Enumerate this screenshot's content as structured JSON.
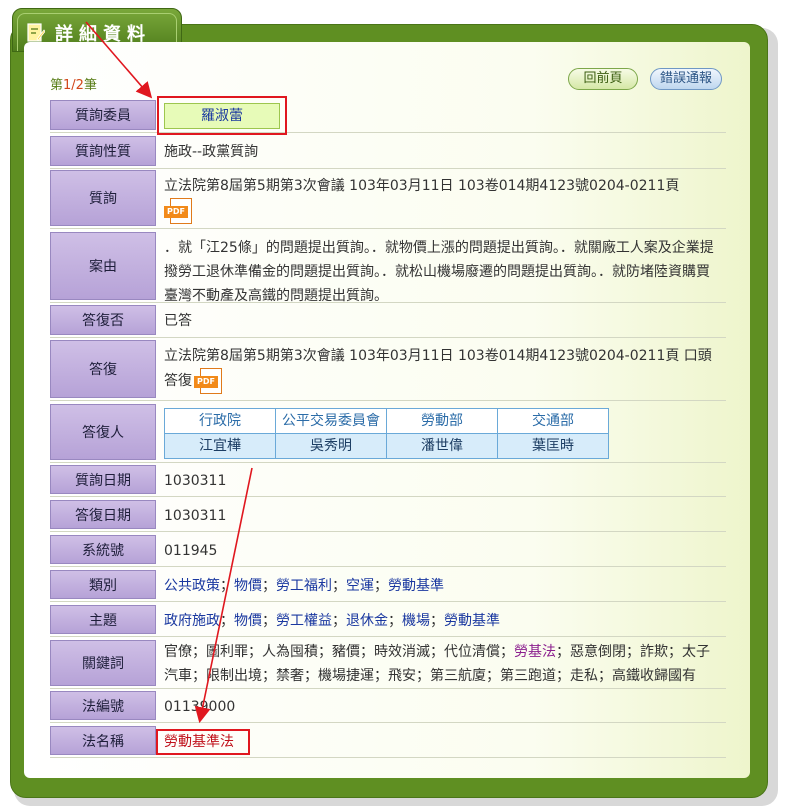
{
  "header": {
    "title": "詳細資料"
  },
  "page_indicator": {
    "prefix": "第",
    "current": "1/2",
    "suffix": "筆"
  },
  "buttons": {
    "back": "回前頁",
    "report": "錯誤通報"
  },
  "fields": {
    "questioner": {
      "label": "質詢委員",
      "value": "羅淑蕾"
    },
    "nature": {
      "label": "質詢性質",
      "value": "施政--政黨質詢"
    },
    "inquiry": {
      "label": "質詢",
      "value": "立法院第8屆第5期第3次會議 103年03月11日 103卷014期4123號0204-0211頁"
    },
    "subject": {
      "label": "案由",
      "value": "．就「江25條」的問題提出質詢。．就物價上漲的問題提出質詢。．就關廠工人案及企業提撥勞工退休準備金的問題提出質詢。．就松山機場廢遷的問題提出質詢。．就防堵陸資購買臺灣不動產及高鐵的問題提出質詢。"
    },
    "replied": {
      "label": "答復否",
      "value": "已答"
    },
    "reply": {
      "label": "答復",
      "value": "立法院第8屆第5期第3次會議 103年03月11日 103卷014期4123號0204-0211頁 口頭答復"
    },
    "respondent": {
      "label": "答復人",
      "agencies": [
        "行政院",
        "公平交易委員會",
        "勞動部",
        "交通部"
      ],
      "names": [
        "江宜樺",
        "吳秀明",
        "潘世偉",
        "葉匡時"
      ]
    },
    "inquiry_date": {
      "label": "質詢日期",
      "value": "1030311"
    },
    "reply_date": {
      "label": "答復日期",
      "value": "1030311"
    },
    "system_no": {
      "label": "系統號",
      "value": "011945"
    },
    "category": {
      "label": "類別",
      "items": [
        "公共政策",
        "物價",
        "勞工福利",
        "空運",
        "勞動基準"
      ],
      "separator": "；"
    },
    "topic": {
      "label": "主題",
      "items": [
        "政府施政",
        "物價",
        "勞工權益",
        "退休金",
        "機場",
        "勞動基準"
      ],
      "separator": "；"
    },
    "keywords": {
      "label": "關鍵詞",
      "before": "官僚；圖利罪；人為囤積；豬價；時效消滅；代位清償；",
      "link": "勞基法",
      "after": "；惡意倒閉；詐欺；太子汽車；限制出境；禁奢；機場捷運；飛安；第三航廈；第三跑道；走私；高鐵收歸國有"
    },
    "law_no": {
      "label": "法編號",
      "value": "01139000"
    },
    "law_name": {
      "label": "法名稱",
      "value": "勞動基準法"
    }
  },
  "icons": {
    "pdf_label": "PDF"
  },
  "colors": {
    "frame": "#5f8f22",
    "label_bg": "#b6a2d7",
    "link": "#1a38a0",
    "highlight": "#e0171f"
  }
}
